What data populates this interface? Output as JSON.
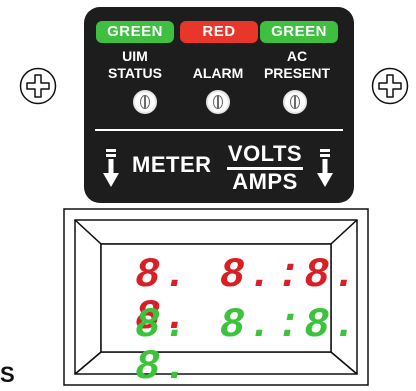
{
  "panel": {
    "indicators": [
      {
        "pill": "GREEN",
        "color": "#3fbf3f",
        "label_line1": "UIM",
        "label_line2": "STATUS"
      },
      {
        "pill": "RED",
        "color": "#e8362a",
        "label_line1": "",
        "label_line2": "ALARM"
      },
      {
        "pill": "GREEN",
        "color": "#3fbf3f",
        "label_line1": "AC",
        "label_line2": "PRESENT"
      }
    ],
    "meter_label": "METER",
    "volts_label": "VOLTS",
    "amps_label": "AMPS"
  },
  "display": {
    "line1": "8. 8.:8. 8.",
    "line2": "8. 8.:8. 8.",
    "line1_color": "#d91f26",
    "line2_color": "#3cc33c"
  },
  "edge_text": "S"
}
